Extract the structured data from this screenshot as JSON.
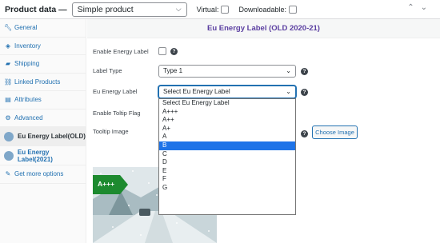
{
  "header": {
    "title": "Product data —",
    "product_type": "Simple product",
    "virtual_label": "Virtual:",
    "downloadable_label": "Downloadable:"
  },
  "sidebar": {
    "items": [
      {
        "label": "General",
        "icon": "wrench-icon"
      },
      {
        "label": "Inventory",
        "icon": "tag-icon"
      },
      {
        "label": "Shipping",
        "icon": "truck-icon"
      },
      {
        "label": "Linked Products",
        "icon": "link-icon"
      },
      {
        "label": "Attributes",
        "icon": "list-icon"
      },
      {
        "label": "Advanced",
        "icon": "gear-icon"
      },
      {
        "label": "Eu Energy Label(OLD)",
        "icon": "plugin-circle-icon"
      },
      {
        "label": "Eu Energy Label(2021)",
        "icon": "plugin-circle-icon"
      },
      {
        "label": "Get more options",
        "icon": "plug-icon"
      }
    ]
  },
  "main": {
    "section_title": "Eu Energy Label (OLD 2020-21)",
    "enable_label": "Enable Energy Label",
    "label_type_label": "Label Type",
    "label_type_value": "Type 1",
    "eu_energy_label": "Eu Energy Label",
    "eu_energy_value": "Select Eu Energy Label",
    "tooltip_flag_label": "Enable Toltip Flag",
    "tooltip_image_label": "Tooltip Image",
    "choose_image_button": "Choose Image",
    "dropdown_options": [
      "Select Eu Energy Label",
      "A+++",
      "A++",
      "A+",
      "A",
      "B",
      "C",
      "D",
      "E",
      "F",
      "G"
    ],
    "highlighted_option": "B",
    "energy_badge": "A+++"
  },
  "colors": {
    "accent": "#2271b1",
    "section_title": "#5b3fa1",
    "highlight": "#1e73e8",
    "badge_green": "#1d8a2f"
  }
}
